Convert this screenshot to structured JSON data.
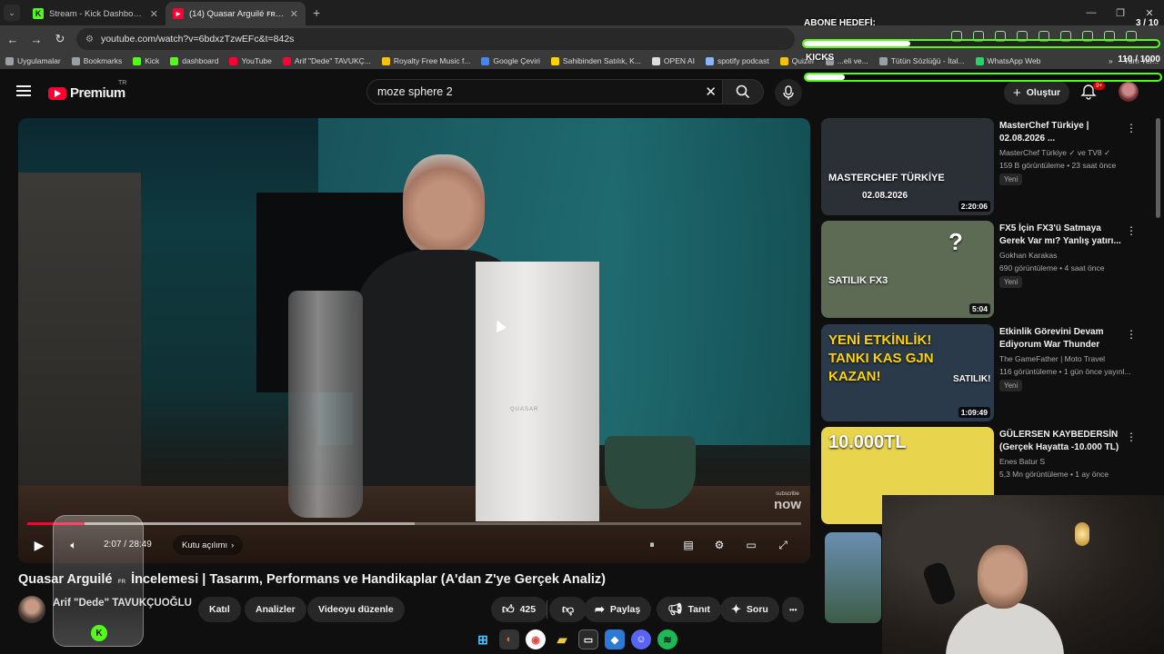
{
  "browser": {
    "tabs": [
      {
        "title": "Stream - Kick Dashboard",
        "favicon": "K",
        "color": "#53fc18",
        "active": false
      },
      {
        "title": "(14) Quasar Arguilé ꜰʀ İncelemesi",
        "favicon": "▶",
        "color": "#ff0033",
        "active": true
      }
    ],
    "new_tab": "+",
    "url": "youtube.com/watch?v=6bdxzTzwEFc&t=842s",
    "bookmarks": [
      {
        "label": "Uygulamalar",
        "color": "#9aa0a6"
      },
      {
        "label": "Bookmarks",
        "color": "#9aa0a6"
      },
      {
        "label": "Kick",
        "color": "#53fc18"
      },
      {
        "label": "dashboard",
        "color": "#53fc18"
      },
      {
        "label": "YouTube",
        "color": "#ff0033"
      },
      {
        "label": "Arif \"Dede\" TAVUKÇ...",
        "color": "#ff0033"
      },
      {
        "label": "Royalty Free Music f...",
        "color": "#f4c20d"
      },
      {
        "label": "Google Çeviri",
        "color": "#4285f4"
      },
      {
        "label": "Sahibinden Satılık, K...",
        "color": "#ffd400"
      },
      {
        "label": "OPEN AI",
        "color": "#dddddd"
      },
      {
        "label": "spotify podcast",
        "color": "#8ab4f8"
      },
      {
        "label": "Quizer",
        "color": "#f4c20d"
      },
      {
        "label": "...eli ve...",
        "color": "#9aa0a6"
      },
      {
        "label": "Tütün Sözlüğü - İtal...",
        "color": "#9aa0a6"
      },
      {
        "label": "WhatsApp Web",
        "color": "#25d366"
      }
    ],
    "bookmarks_more": "»",
    "all_bookmarks": "Tüm Yer..."
  },
  "header": {
    "logo_text": "Premium",
    "country": "TR",
    "search_value": "moze sphere 2",
    "create_label": "Oluştur",
    "notif_count": "9+"
  },
  "player": {
    "current_time": "2:07 / 28:49",
    "chapter_label": "Kutu açılımı",
    "progress": 0.074,
    "buffer": 0.5,
    "box_label": "QUASAR",
    "watermark_small": "subscribe",
    "watermark": "now"
  },
  "video": {
    "title_part1": "Quasar Arguilé",
    "title_badge": "ꜰʀ",
    "title_part2": "İncelemesi | Tasarım, Performans ve Handikaplar (A'dan Z'ye Gerçek Analiz)",
    "channel_name": "Arif \"Dede\" TAVUKÇUOĞLU",
    "buttons": {
      "join": "Katıl",
      "analytics": "Analizler",
      "edit": "Videoyu düzenle",
      "likes": "425",
      "share": "Paylaş",
      "promote": "Tanıt",
      "ask": "Soru",
      "more": "•••"
    }
  },
  "recommendations": [
    {
      "title": "MasterChef Türkiye | 02.08.2026 ...",
      "channel": "MasterChef Türkiye ✓ ve TV8 ✓",
      "meta": "159 B görüntüleme • 23 saat önce",
      "badge": "Yeni",
      "duration": "2:20:06",
      "thumb_text": "MASTERCHEF TÜRKİYE",
      "thumb_sub": "02.08.2026",
      "bg": "#2b2f36"
    },
    {
      "title": "FX5 İçin FX3'ü Satmaya Gerek Var mı? Yanlış yatırı...",
      "channel": "Gokhan Karakas",
      "meta": "690 görüntüleme • 4 saat önce",
      "badge": "Yeni",
      "duration": "5:04",
      "thumb_text": "SATILIK FX3",
      "thumb_sub": "?",
      "bg": "#5d6b55"
    },
    {
      "title": "Etkinlik Görevini Devam Ediyorum War Thunder",
      "channel": "The GameFather | Moto Travel",
      "meta": "116 görüntüleme • 1 gün önce yayınl...",
      "badge": "Yeni",
      "duration": "1:09:49",
      "thumb_text": "YENİ ETKİNLİK! TANKI KAS GJN KAZAN!",
      "thumb_sub": "SATILIK!",
      "bg": "#2a3a4a"
    },
    {
      "title": "GÜLERSEN KAYBEDERSİN (Gerçek Hayatta -10.000 TL)",
      "channel": "Enes Batur S",
      "meta": "5,3 Mn görüntüleme • 1 ay önce",
      "badge": "",
      "duration": "",
      "thumb_text": "10.000TL",
      "thumb_sub": "",
      "bg": "#e8d44d"
    }
  ],
  "overlay": {
    "goal_title": "ABONE HEDEFİ:",
    "goal_count": "3 / 10",
    "goal_progress": 0.3,
    "kicks_title": "KICKS",
    "kicks_count": "110 / 1000",
    "kicks_progress": 0.11
  },
  "colors": {
    "kick_green": "#53fc18",
    "yt_red": "#ff0033"
  }
}
